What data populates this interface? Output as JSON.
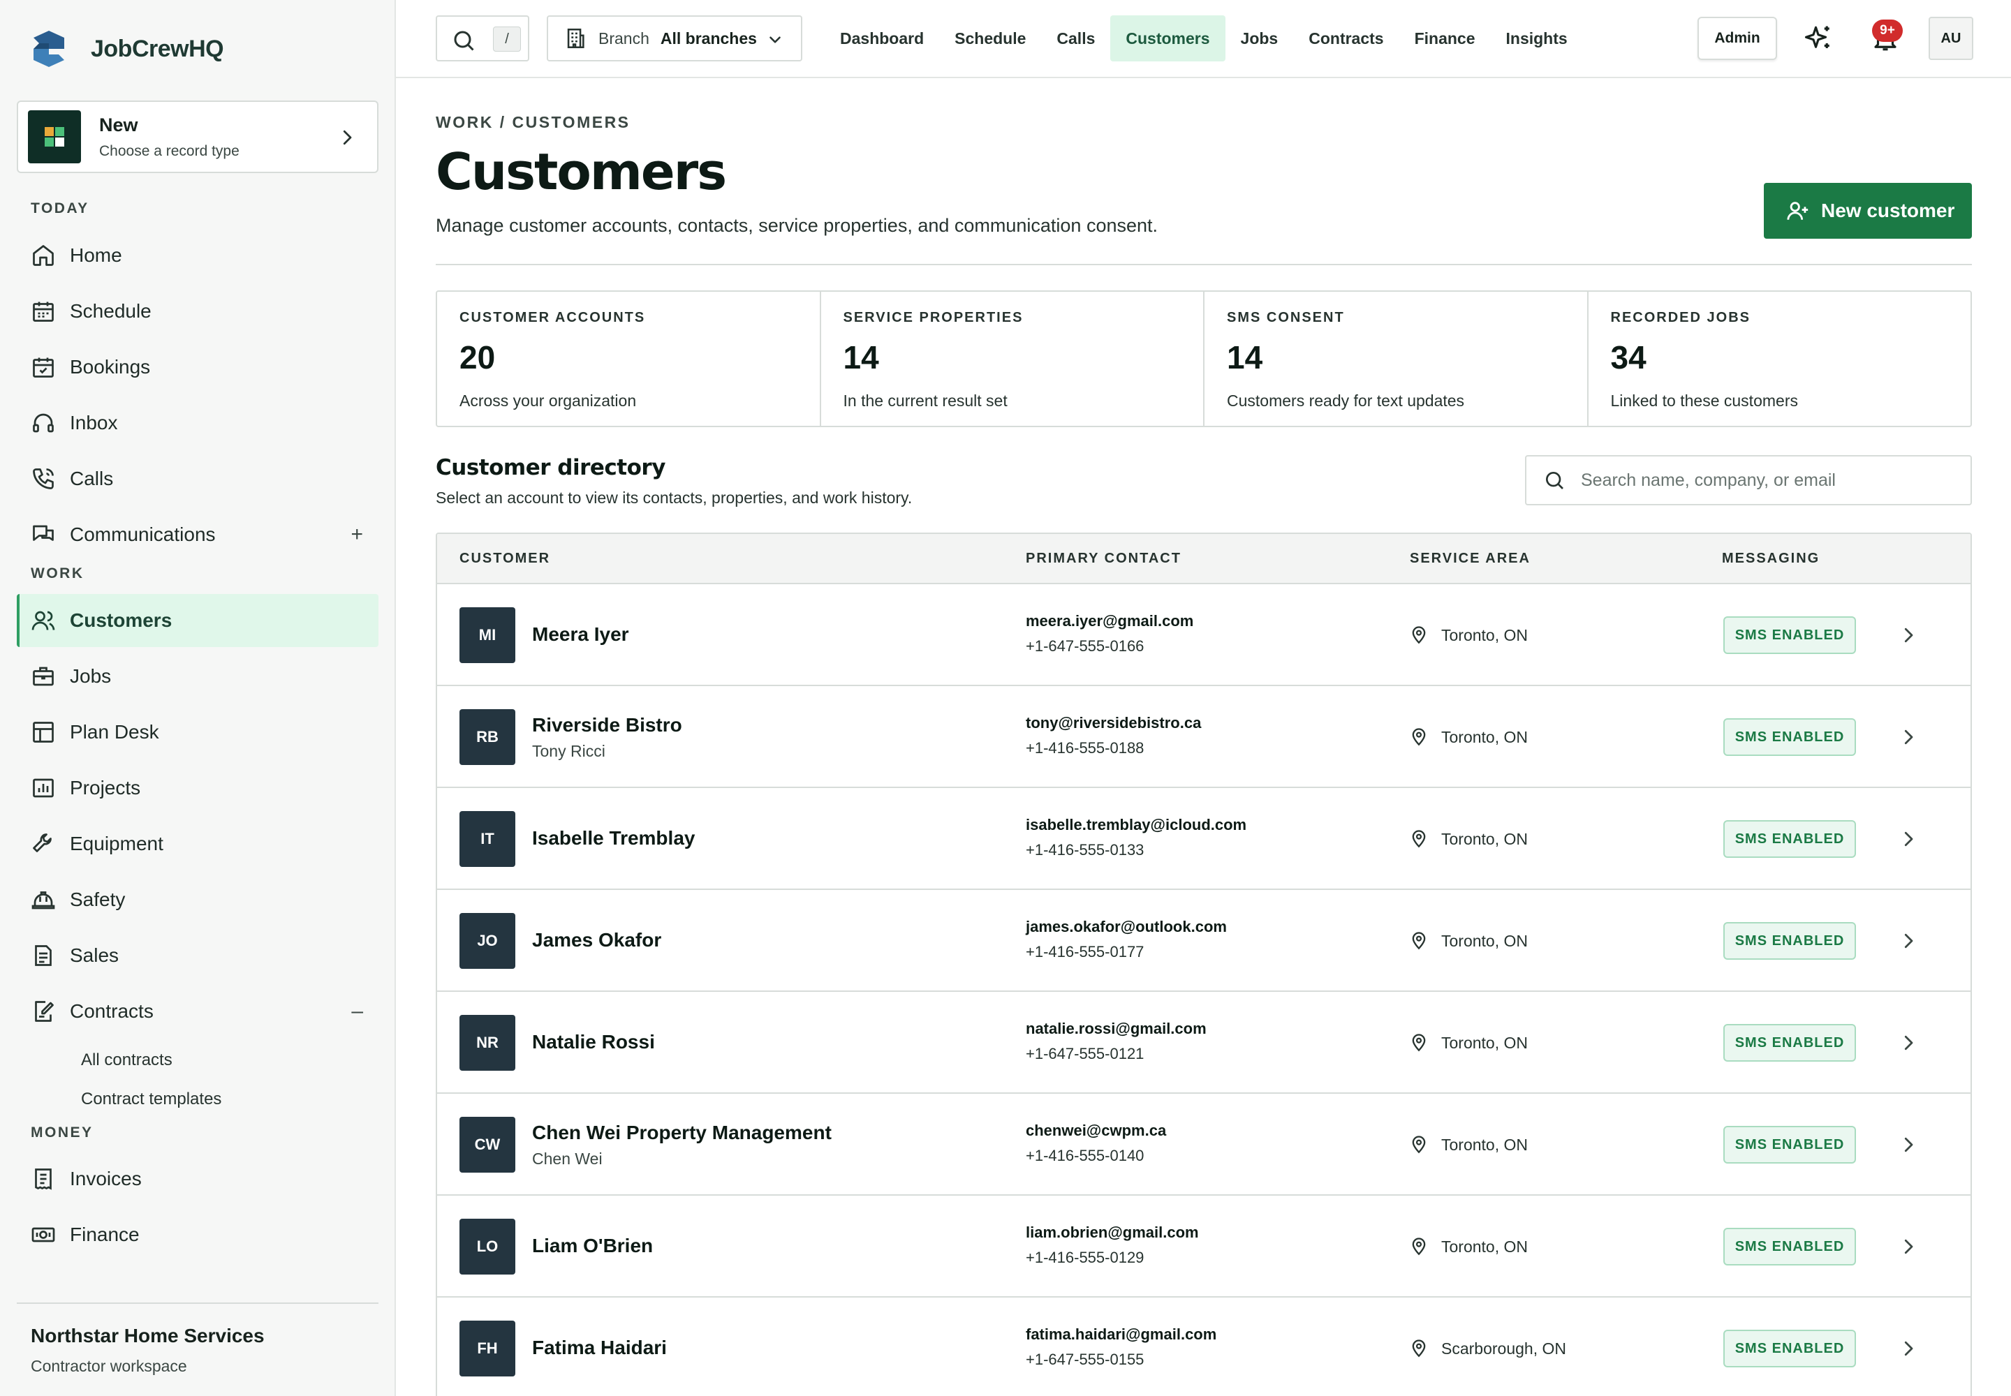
{
  "app": {
    "name": "JobCrewHQ"
  },
  "new_card": {
    "title": "New",
    "subtitle": "Choose a record type"
  },
  "sidebar": {
    "sections": {
      "today": "TODAY",
      "work": "WORK",
      "money": "MONEY"
    },
    "today_items": [
      {
        "label": "Home",
        "icon": "home-icon"
      },
      {
        "label": "Schedule",
        "icon": "calendar-grid-icon"
      },
      {
        "label": "Bookings",
        "icon": "calendar-check-icon"
      },
      {
        "label": "Inbox",
        "icon": "headset-icon"
      },
      {
        "label": "Calls",
        "icon": "phone-icon"
      },
      {
        "label": "Communications",
        "icon": "chat-bubbles-icon",
        "toggle": "+"
      }
    ],
    "work_items": [
      {
        "label": "Customers",
        "icon": "users-icon",
        "active": true
      },
      {
        "label": "Jobs",
        "icon": "briefcase-icon"
      },
      {
        "label": "Plan Desk",
        "icon": "layout-icon"
      },
      {
        "label": "Projects",
        "icon": "chart-board-icon"
      },
      {
        "label": "Equipment",
        "icon": "wrench-icon"
      },
      {
        "label": "Safety",
        "icon": "hard-hat-icon"
      },
      {
        "label": "Sales",
        "icon": "document-icon"
      },
      {
        "label": "Contracts",
        "icon": "contract-edit-icon",
        "toggle": "–"
      }
    ],
    "contracts_sub": [
      "All contracts",
      "Contract templates"
    ],
    "money_items": [
      {
        "label": "Invoices",
        "icon": "invoice-icon"
      },
      {
        "label": "Finance",
        "icon": "cash-icon"
      }
    ],
    "org": {
      "name": "Northstar Home Services",
      "type": "Contractor workspace"
    }
  },
  "topbar": {
    "search_kbd": "/",
    "branch_label": "Branch",
    "branch_value": "All branches",
    "tabs": [
      "Dashboard",
      "Schedule",
      "Calls",
      "Customers",
      "Jobs",
      "Contracts",
      "Finance",
      "Insights"
    ],
    "active_tab": "Customers",
    "admin_label": "Admin",
    "notifications_badge": "9+",
    "avatar_initials": "AU"
  },
  "page": {
    "breadcrumb": "WORK / CUSTOMERS",
    "title": "Customers",
    "subtitle": "Manage customer accounts, contacts, service properties, and communication consent.",
    "new_button": "New customer"
  },
  "stats": [
    {
      "label": "CUSTOMER ACCOUNTS",
      "value": "20",
      "desc": "Across your organization"
    },
    {
      "label": "SERVICE PROPERTIES",
      "value": "14",
      "desc": "In the current result set"
    },
    {
      "label": "SMS CONSENT",
      "value": "14",
      "desc": "Customers ready for text updates"
    },
    {
      "label": "RECORDED JOBS",
      "value": "34",
      "desc": "Linked to these customers"
    }
  ],
  "directory": {
    "title": "Customer directory",
    "subtitle": "Select an account to view its contacts, properties, and work history.",
    "search_placeholder": "Search name, company, or email",
    "columns": [
      "CUSTOMER",
      "PRIMARY CONTACT",
      "SERVICE AREA",
      "MESSAGING"
    ],
    "rows": [
      {
        "initials": "MI",
        "name": "Meera Iyer",
        "contact_name": "",
        "email": "meera.iyer@gmail.com",
        "phone": "+1-647-555-0166",
        "area": "Toronto, ON",
        "messaging": "SMS ENABLED"
      },
      {
        "initials": "RB",
        "name": "Riverside Bistro",
        "contact_name": "Tony Ricci",
        "email": "tony@riversidebistro.ca",
        "phone": "+1-416-555-0188",
        "area": "Toronto, ON",
        "messaging": "SMS ENABLED"
      },
      {
        "initials": "IT",
        "name": "Isabelle Tremblay",
        "contact_name": "",
        "email": "isabelle.tremblay@icloud.com",
        "phone": "+1-416-555-0133",
        "area": "Toronto, ON",
        "messaging": "SMS ENABLED"
      },
      {
        "initials": "JO",
        "name": "James Okafor",
        "contact_name": "",
        "email": "james.okafor@outlook.com",
        "phone": "+1-416-555-0177",
        "area": "Toronto, ON",
        "messaging": "SMS ENABLED"
      },
      {
        "initials": "NR",
        "name": "Natalie Rossi",
        "contact_name": "",
        "email": "natalie.rossi@gmail.com",
        "phone": "+1-647-555-0121",
        "area": "Toronto, ON",
        "messaging": "SMS ENABLED"
      },
      {
        "initials": "CW",
        "name": "Chen Wei Property Management",
        "contact_name": "Chen Wei",
        "email": "chenwei@cwpm.ca",
        "phone": "+1-416-555-0140",
        "area": "Toronto, ON",
        "messaging": "SMS ENABLED"
      },
      {
        "initials": "LO",
        "name": "Liam O'Brien",
        "contact_name": "",
        "email": "liam.obrien@gmail.com",
        "phone": "+1-416-555-0129",
        "area": "Toronto, ON",
        "messaging": "SMS ENABLED"
      },
      {
        "initials": "FH",
        "name": "Fatima Haidari",
        "contact_name": "",
        "email": "fatima.haidari@gmail.com",
        "phone": "+1-647-555-0155",
        "area": "Scarborough, ON",
        "messaging": "SMS ENABLED"
      }
    ]
  },
  "colors": {
    "accent": "#1b7a45",
    "active_nav_bg": "#e0f7ea",
    "pill_bg": "#eaf7f0",
    "avatar_bg": "#243540"
  }
}
